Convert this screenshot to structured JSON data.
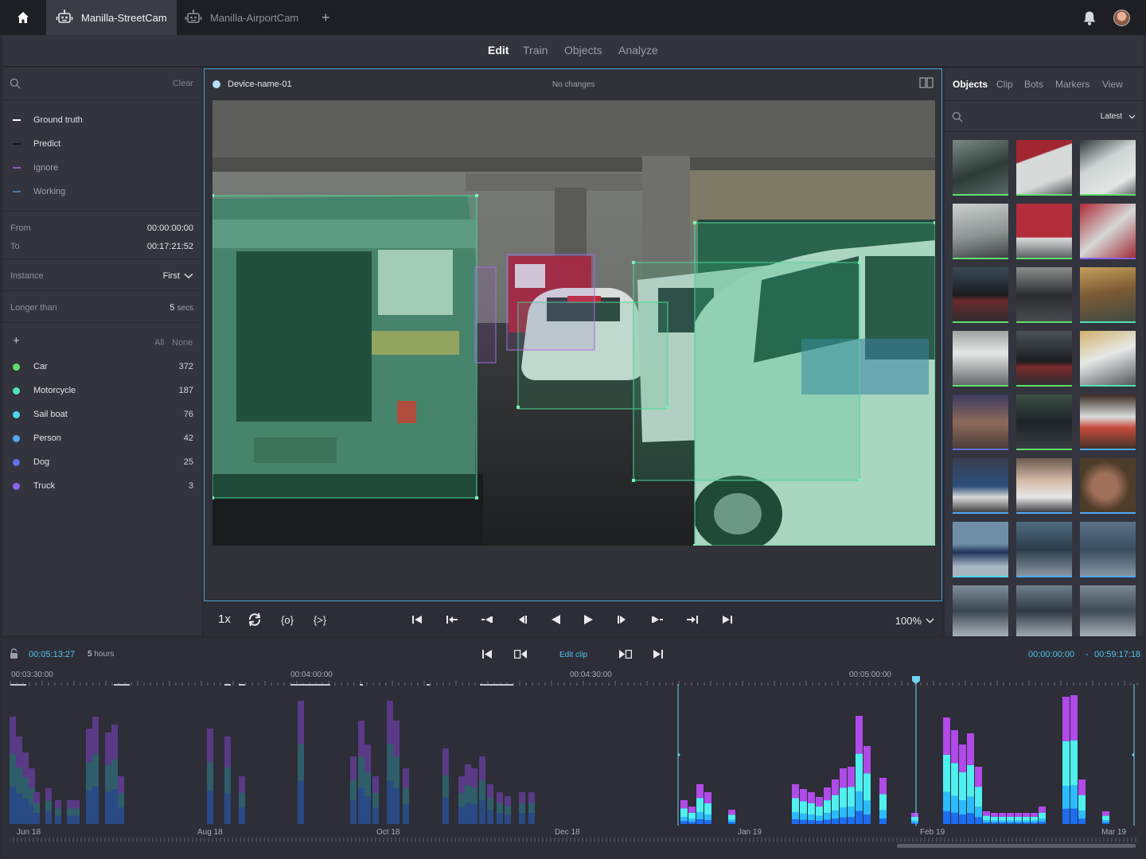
{
  "topbar": {
    "tabs": [
      {
        "label": "Manilla-StreetCam",
        "active": true
      },
      {
        "label": "Manilla-AirportCam",
        "active": false
      }
    ],
    "add_label": "+"
  },
  "modes": [
    {
      "label": "Edit",
      "active": true
    },
    {
      "label": "Train",
      "active": false
    },
    {
      "label": "Objects",
      "active": false
    },
    {
      "label": "Analyze",
      "active": false
    }
  ],
  "filters": {
    "clear_label": "Clear",
    "legend": [
      {
        "label": "Ground truth",
        "color": "#ffffff"
      },
      {
        "label": "Predict",
        "color": "#111111"
      },
      {
        "label": "Ignore",
        "color": "#9b53c9"
      },
      {
        "label": "Working",
        "color": "#3f7fb8"
      }
    ],
    "from_label": "From",
    "from_value": "00:00:00:00",
    "to_label": "To",
    "to_value": "00:17:21:52",
    "instance_label": "Instance",
    "instance_value": "First",
    "longer_label": "Longer than",
    "longer_value": "5",
    "longer_unit": "secs",
    "add_label": "+",
    "all_label": "All",
    "none_label": "None",
    "objects": [
      {
        "label": "Car",
        "count": "372",
        "color": "#5fe06a"
      },
      {
        "label": "Motorcycle",
        "count": "187",
        "color": "#4fe3b5"
      },
      {
        "label": "Sail boat",
        "count": "76",
        "color": "#4fd6ee"
      },
      {
        "label": "Person",
        "count": "42",
        "color": "#4ea8f4"
      },
      {
        "label": "Dog",
        "count": "25",
        "color": "#5c73ee"
      },
      {
        "label": "Truck",
        "count": "3",
        "color": "#8a63f0"
      }
    ]
  },
  "viewer": {
    "device_name": "Device-name-01",
    "status": "No changes"
  },
  "playback": {
    "speed": "1x",
    "zoom": "100%"
  },
  "right_panel": {
    "tabs": [
      {
        "label": "Objects",
        "active": true
      },
      {
        "label": "Clip",
        "active": false
      },
      {
        "label": "Bots",
        "active": false
      },
      {
        "label": "Markers",
        "active": false
      },
      {
        "label": "View",
        "active": false
      }
    ],
    "sort_label": "Latest"
  },
  "timeline": {
    "current_time": "00:05:13:27",
    "duration": "5",
    "duration_unit": "hours",
    "edit_clip_label": "Edit clip",
    "range_start": "00:00:00:00",
    "range_sep": "-",
    "range_end": "00:59:17:18",
    "ruler": [
      "00:03:30:00",
      "00:04:00:00",
      "00:04:30:00",
      "00:05:00:00"
    ],
    "months": [
      "Jun 18",
      "Aug 18",
      "Oct 18",
      "Dec 18",
      "Jan 19",
      "Feb 19",
      "Mar 19"
    ]
  }
}
